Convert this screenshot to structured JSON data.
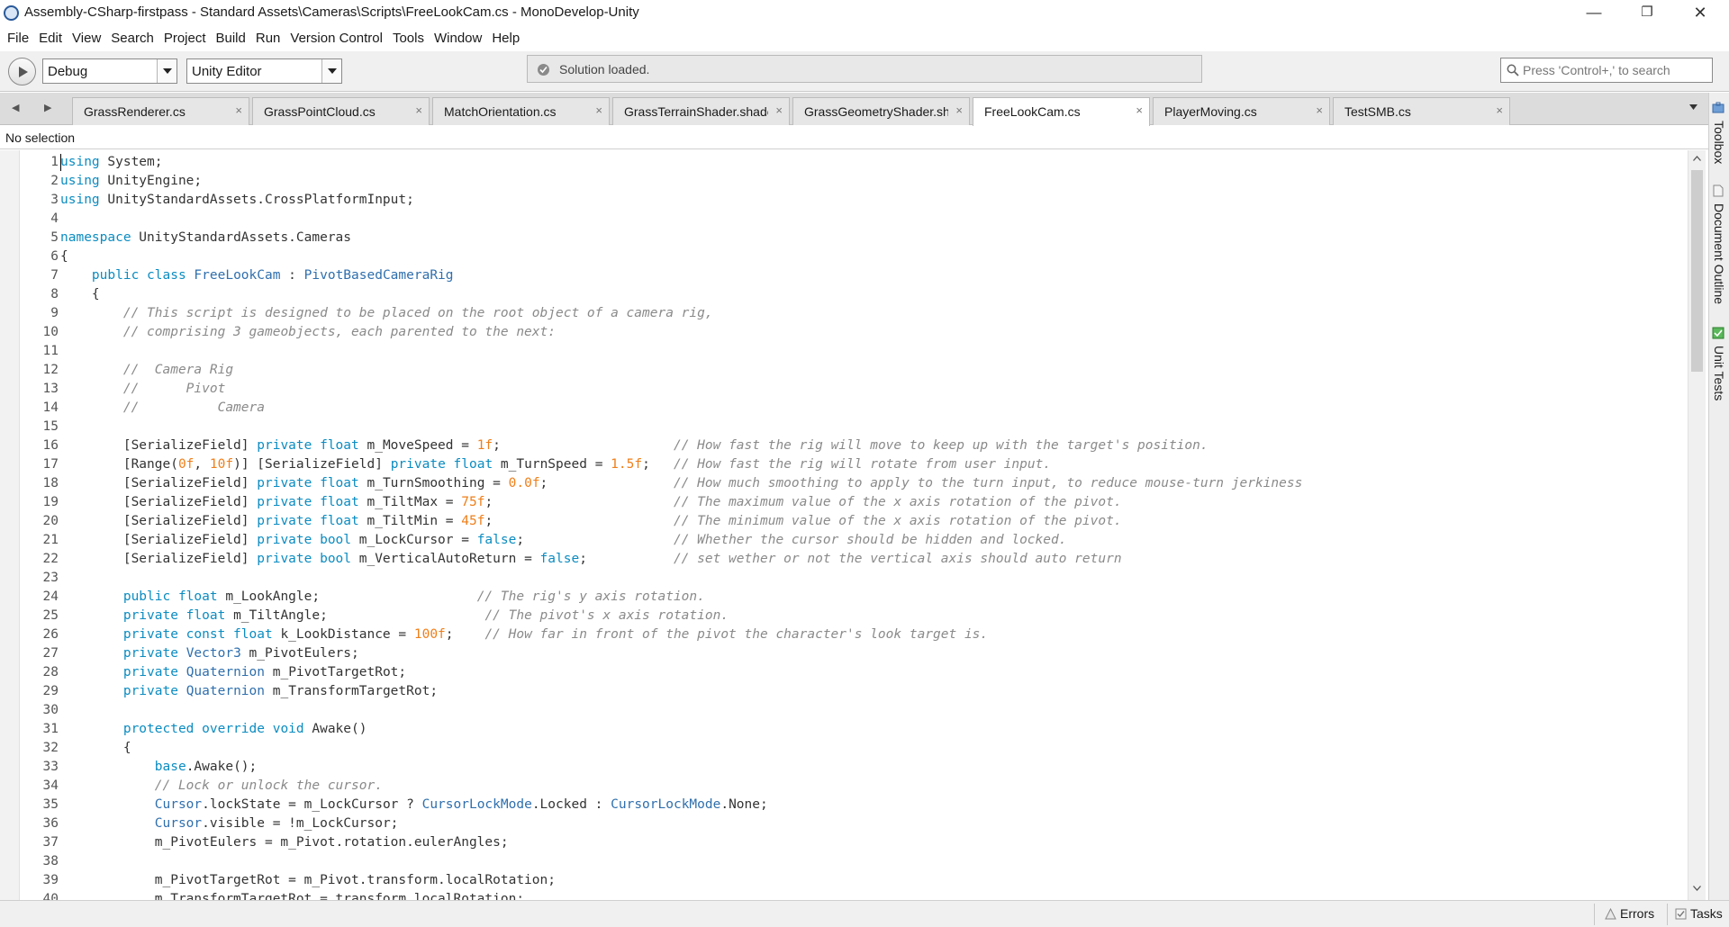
{
  "window": {
    "title": "Assembly-CSharp-firstpass - Standard Assets\\Cameras\\Scripts\\FreeLookCam.cs - MonoDevelop-Unity",
    "minimize_glyph": "—",
    "maximize_glyph": "❐",
    "close_glyph": "✕"
  },
  "menu": [
    "File",
    "Edit",
    "View",
    "Search",
    "Project",
    "Build",
    "Run",
    "Version Control",
    "Tools",
    "Window",
    "Help"
  ],
  "toolbar": {
    "configuration": "Debug",
    "target": "Unity Editor",
    "status": "Solution loaded.",
    "search_placeholder": "Press 'Control+,' to search"
  },
  "tabs": [
    {
      "label": "GrassRenderer.cs",
      "active": false
    },
    {
      "label": "GrassPointCloud.cs",
      "active": false
    },
    {
      "label": "MatchOrientation.cs",
      "active": false
    },
    {
      "label": "GrassTerrainShader.shader",
      "active": false
    },
    {
      "label": "GrassGeometryShader.shader",
      "active": false
    },
    {
      "label": "FreeLookCam.cs",
      "active": true
    },
    {
      "label": "PlayerMoving.cs",
      "active": false
    },
    {
      "label": "TestSMB.cs",
      "active": false
    }
  ],
  "tab_close_glyph": "×",
  "nav": {
    "back": "◀",
    "forward": "▶"
  },
  "breadcrumb": "No selection",
  "right_dock": [
    "Toolbox",
    "Document Outline",
    "Unit Tests"
  ],
  "status_pads": {
    "errors": "Errors",
    "tasks": "Tasks"
  },
  "colors": {
    "keyword": "#0b8cc1",
    "type": "#2f6fad",
    "number": "#ef7f1a",
    "comment": "#8a8a8a"
  },
  "editor": {
    "file": "FreeLookCam.cs",
    "lines": [
      [
        [
          "kw",
          "using"
        ],
        [
          "pl",
          " System;"
        ]
      ],
      [
        [
          "kw",
          "using"
        ],
        [
          "pl",
          " UnityEngine;"
        ]
      ],
      [
        [
          "kw",
          "using"
        ],
        [
          "pl",
          " UnityStandardAssets.CrossPlatformInput;"
        ]
      ],
      [],
      [
        [
          "kw",
          "namespace"
        ],
        [
          "pl",
          " UnityStandardAssets.Cameras"
        ]
      ],
      [
        [
          "pl",
          "{"
        ]
      ],
      [
        [
          "pl",
          "    "
        ],
        [
          "kw",
          "public class "
        ],
        [
          "type",
          "FreeLookCam"
        ],
        [
          "pl",
          " : "
        ],
        [
          "type",
          "PivotBasedCameraRig"
        ]
      ],
      [
        [
          "pl",
          "    {"
        ]
      ],
      [
        [
          "pl",
          "        "
        ],
        [
          "com",
          "// This script is designed to be placed on the root object of a camera rig,"
        ]
      ],
      [
        [
          "pl",
          "        "
        ],
        [
          "com",
          "// comprising 3 gameobjects, each parented to the next:"
        ]
      ],
      [],
      [
        [
          "pl",
          "        "
        ],
        [
          "com",
          "//  Camera Rig"
        ]
      ],
      [
        [
          "pl",
          "        "
        ],
        [
          "com",
          "//      Pivot"
        ]
      ],
      [
        [
          "pl",
          "        "
        ],
        [
          "com",
          "//          Camera"
        ]
      ],
      [],
      [
        [
          "pl",
          "        [SerializeField] "
        ],
        [
          "kw",
          "private float"
        ],
        [
          "pl",
          " m_MoveSpeed = "
        ],
        [
          "num",
          "1f"
        ],
        [
          "pl",
          ";                      "
        ],
        [
          "com",
          "// How fast the rig will move to keep up with the target's position."
        ]
      ],
      [
        [
          "pl",
          "        [Range("
        ],
        [
          "num",
          "0f"
        ],
        [
          "pl",
          ", "
        ],
        [
          "num",
          "10f"
        ],
        [
          "pl",
          ")] [SerializeField] "
        ],
        [
          "kw",
          "private float"
        ],
        [
          "pl",
          " m_TurnSpeed = "
        ],
        [
          "num",
          "1.5f"
        ],
        [
          "pl",
          ";   "
        ],
        [
          "com",
          "// How fast the rig will rotate from user input."
        ]
      ],
      [
        [
          "pl",
          "        [SerializeField] "
        ],
        [
          "kw",
          "private float"
        ],
        [
          "pl",
          " m_TurnSmoothing = "
        ],
        [
          "num",
          "0.0f"
        ],
        [
          "pl",
          ";                "
        ],
        [
          "com",
          "// How much smoothing to apply to the turn input, to reduce mouse-turn jerkiness"
        ]
      ],
      [
        [
          "pl",
          "        [SerializeField] "
        ],
        [
          "kw",
          "private float"
        ],
        [
          "pl",
          " m_TiltMax = "
        ],
        [
          "num",
          "75f"
        ],
        [
          "pl",
          ";                       "
        ],
        [
          "com",
          "// The maximum value of the x axis rotation of the pivot."
        ]
      ],
      [
        [
          "pl",
          "        [SerializeField] "
        ],
        [
          "kw",
          "private float"
        ],
        [
          "pl",
          " m_TiltMin = "
        ],
        [
          "num",
          "45f"
        ],
        [
          "pl",
          ";                       "
        ],
        [
          "com",
          "// The minimum value of the x axis rotation of the pivot."
        ]
      ],
      [
        [
          "pl",
          "        [SerializeField] "
        ],
        [
          "kw",
          "private bool"
        ],
        [
          "pl",
          " m_LockCursor = "
        ],
        [
          "kw",
          "false"
        ],
        [
          "pl",
          ";                   "
        ],
        [
          "com",
          "// Whether the cursor should be hidden and locked."
        ]
      ],
      [
        [
          "pl",
          "        [SerializeField] "
        ],
        [
          "kw",
          "private bool"
        ],
        [
          "pl",
          " m_VerticalAutoReturn = "
        ],
        [
          "kw",
          "false"
        ],
        [
          "pl",
          ";           "
        ],
        [
          "com",
          "// set wether or not the vertical axis should auto return"
        ]
      ],
      [],
      [
        [
          "pl",
          "        "
        ],
        [
          "kw",
          "public float"
        ],
        [
          "pl",
          " m_LookAngle;                    "
        ],
        [
          "com",
          "// The rig's y axis rotation."
        ]
      ],
      [
        [
          "pl",
          "        "
        ],
        [
          "kw",
          "private float"
        ],
        [
          "pl",
          " m_TiltAngle;                    "
        ],
        [
          "com",
          "// The pivot's x axis rotation."
        ]
      ],
      [
        [
          "pl",
          "        "
        ],
        [
          "kw",
          "private const float"
        ],
        [
          "pl",
          " k_LookDistance = "
        ],
        [
          "num",
          "100f"
        ],
        [
          "pl",
          ";    "
        ],
        [
          "com",
          "// How far in front of the pivot the character's look target is."
        ]
      ],
      [
        [
          "pl",
          "        "
        ],
        [
          "kw",
          "private "
        ],
        [
          "type",
          "Vector3"
        ],
        [
          "pl",
          " m_PivotEulers;"
        ]
      ],
      [
        [
          "pl",
          "        "
        ],
        [
          "kw",
          "private "
        ],
        [
          "type",
          "Quaternion"
        ],
        [
          "pl",
          " m_PivotTargetRot;"
        ]
      ],
      [
        [
          "pl",
          "        "
        ],
        [
          "kw",
          "private "
        ],
        [
          "type",
          "Quaternion"
        ],
        [
          "pl",
          " m_TransformTargetRot;"
        ]
      ],
      [],
      [
        [
          "pl",
          "        "
        ],
        [
          "kw",
          "protected override void"
        ],
        [
          "pl",
          " Awake()"
        ]
      ],
      [
        [
          "pl",
          "        {"
        ]
      ],
      [
        [
          "pl",
          "            "
        ],
        [
          "kw",
          "base"
        ],
        [
          "pl",
          ".Awake();"
        ]
      ],
      [
        [
          "pl",
          "            "
        ],
        [
          "com",
          "// Lock or unlock the cursor."
        ]
      ],
      [
        [
          "pl",
          "            "
        ],
        [
          "type",
          "Cursor"
        ],
        [
          "pl",
          ".lockState = m_LockCursor ? "
        ],
        [
          "type",
          "CursorLockMode"
        ],
        [
          "pl",
          ".Locked : "
        ],
        [
          "type",
          "CursorLockMode"
        ],
        [
          "pl",
          ".None;"
        ]
      ],
      [
        [
          "pl",
          "            "
        ],
        [
          "type",
          "Cursor"
        ],
        [
          "pl",
          ".visible = !m_LockCursor;"
        ]
      ],
      [
        [
          "pl",
          "            m_PivotEulers = m_Pivot.rotation.eulerAngles;"
        ]
      ],
      [],
      [
        [
          "pl",
          "            m_PivotTargetRot = m_Pivot.transform.localRotation;"
        ]
      ],
      [
        [
          "pl",
          "            m_TransformTargetRot = transform.localRotation;"
        ]
      ]
    ]
  }
}
